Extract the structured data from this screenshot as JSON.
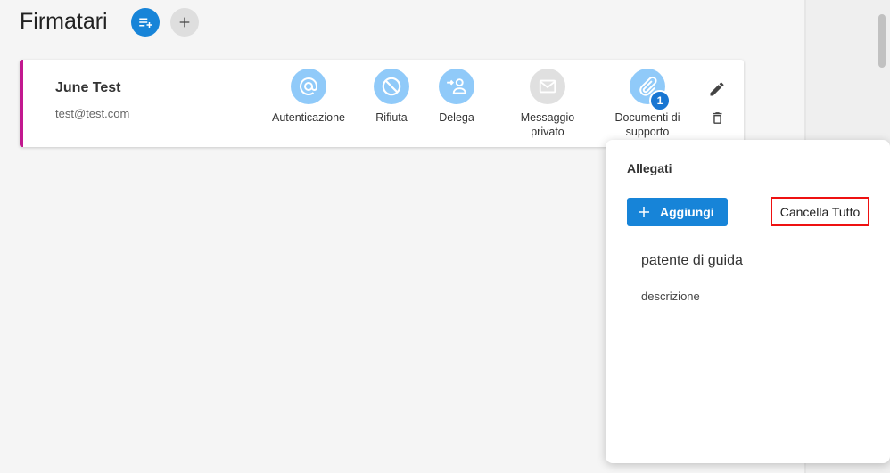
{
  "page": {
    "title": "Firmatari"
  },
  "signer": {
    "name": "June Test",
    "email": "test@test.com",
    "accent_color": "#c2188f"
  },
  "actions": [
    {
      "label": "Autenticazione",
      "icon": "at-icon",
      "state": "active"
    },
    {
      "label": "Rifiuta",
      "icon": "block-icon",
      "state": "active"
    },
    {
      "label": "Delega",
      "icon": "delegate-icon",
      "state": "active"
    },
    {
      "label": "Messaggio privato",
      "icon": "mail-icon",
      "state": "inactive"
    },
    {
      "label": "Documenti di supporto",
      "icon": "paperclip-icon",
      "state": "active",
      "badge": "1"
    }
  ],
  "attachments_popup": {
    "title": "Allegati",
    "add_label": "Aggiungi",
    "clear_label": "Cancella Tutto",
    "items": [
      {
        "name": "patente di guida",
        "description": "descrizione"
      }
    ]
  },
  "colors": {
    "primary": "#1784d8",
    "light_blue": "#90caf9",
    "highlight": "#e11111"
  }
}
